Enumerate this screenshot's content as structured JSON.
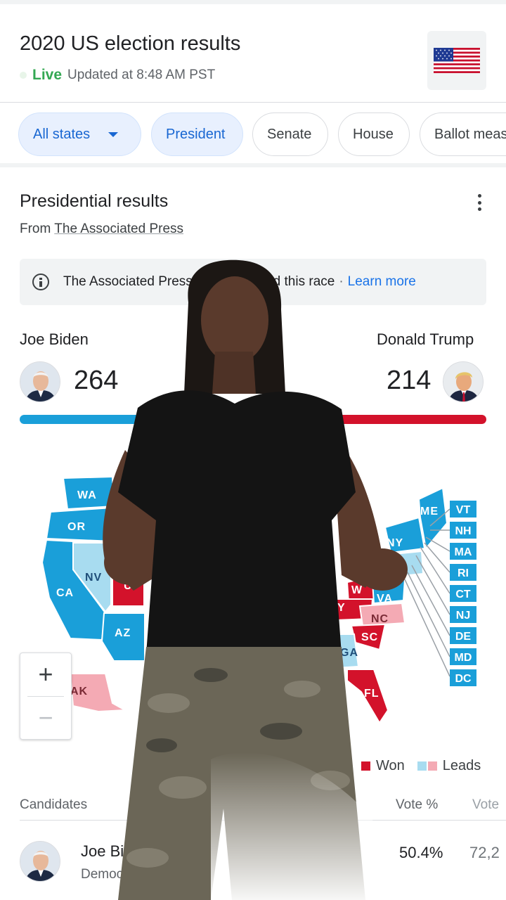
{
  "header": {
    "title": "2020 US election results",
    "live_label": "Live",
    "updated_text": "Updated at 8:48 AM PST",
    "flag_icon": "us-flag-icon"
  },
  "chips": [
    {
      "label": "All states",
      "active": true,
      "has_dropdown": true
    },
    {
      "label": "President",
      "active": true
    },
    {
      "label": "Senate",
      "active": false
    },
    {
      "label": "House",
      "active": false
    },
    {
      "label": "Ballot meas",
      "active": false
    }
  ],
  "results": {
    "title": "Presidential results",
    "source_prefix": "From",
    "source_link": "The Associated Press",
    "notice_text_a": "The Associated Press h",
    "notice_text_b": "called this race",
    "notice_sep": "·",
    "notice_link": "Learn more"
  },
  "candidates": {
    "left": {
      "name": "Joe Biden",
      "electoral_votes": "264",
      "color": "#1a9fd9"
    },
    "right": {
      "name": "Donald Trump",
      "electoral_votes": "214",
      "color": "#d3122b"
    },
    "total_electoral": 538
  },
  "map": {
    "state_labels": [
      "WA",
      "OR",
      "NV",
      "CA",
      "AZ",
      "AK",
      "U",
      "ME",
      "NY",
      "W",
      "VA",
      "NC",
      "SC",
      "Y",
      "GA",
      "FL"
    ],
    "small_states": [
      "VT",
      "NH",
      "MA",
      "RI",
      "CT",
      "NJ",
      "DE",
      "MD",
      "DC"
    ],
    "zoom_in": "+",
    "zoom_out": "−",
    "colors": {
      "won_dem": "#1a9fd9",
      "won_rep": "#d3122b",
      "leads_dem": "#a8dcf0",
      "leads_rep": "#f4aab4"
    }
  },
  "legend": {
    "won": "Won",
    "leads": "Leads"
  },
  "table": {
    "col_candidates": "Candidates",
    "col_vote_pct": "Vote %",
    "col_votes": "Vote",
    "rows": [
      {
        "name": "Joe Biden",
        "party": "Democratic Party",
        "vote_pct": "50.4%",
        "votes": "72,2"
      }
    ]
  }
}
